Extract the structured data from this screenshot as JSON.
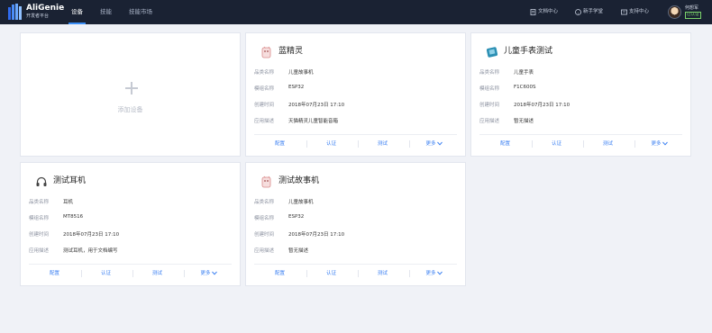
{
  "header": {
    "brand_name": "AliGenie",
    "brand_sub": "开发者平台",
    "nav": [
      "设备",
      "技能",
      "技能市场"
    ],
    "links": [
      {
        "label": "文档中心",
        "icon": "doc-icon"
      },
      {
        "label": "新手学堂",
        "icon": "help-icon"
      },
      {
        "label": "支持中心",
        "icon": "support-icon"
      }
    ],
    "user_name": "何想军",
    "user_badge": "已认证"
  },
  "add_device_label": "添加设备",
  "field_labels": [
    "品类名称",
    "模组名称",
    "创建时间",
    "应用描述"
  ],
  "actions": [
    "配置",
    "认证",
    "测试",
    "更多"
  ],
  "devices": [
    {
      "title": "蓝精灵",
      "icon": "cup-icon",
      "category": "儿童故事机",
      "module": "ESP32",
      "created": "2018年07月23日 17:10",
      "desc": "天猫精灵儿童智能音箱"
    },
    {
      "title": "儿童手表测试",
      "icon": "box-icon",
      "category": "儿童手表",
      "module": "F1C600S",
      "created": "2018年07月23日 17:10",
      "desc": "暂无描述"
    },
    {
      "title": "测试耳机",
      "icon": "headphone-icon",
      "category": "耳机",
      "module": "MT8516",
      "created": "2018年07月23日 17:10",
      "desc": "测试耳机，用于文档编写"
    },
    {
      "title": "测试故事机",
      "icon": "cup-icon",
      "category": "儿童故事机",
      "module": "ESP32",
      "created": "2018年07月23日 17:10",
      "desc": "暂无描述"
    }
  ],
  "colors": {
    "topbar": "#1a2233",
    "accent": "#3a7ff2",
    "page_bg": "#f0f2f7"
  }
}
